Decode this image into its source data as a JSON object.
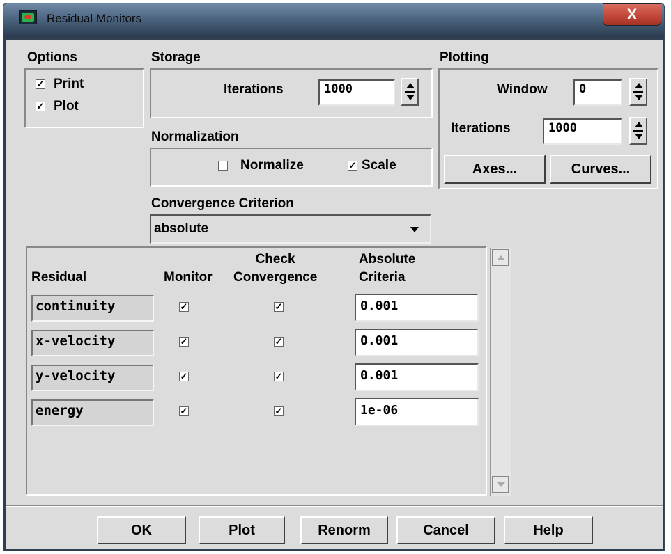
{
  "window": {
    "title": "Residual Monitors",
    "close_glyph": "X"
  },
  "options": {
    "label": "Options",
    "print": {
      "label": "Print",
      "checked": true
    },
    "plot": {
      "label": "Plot",
      "checked": true
    }
  },
  "storage": {
    "label": "Storage",
    "iterations_label": "Iterations",
    "iterations_value": "1000"
  },
  "normalization": {
    "label": "Normalization",
    "normalize": {
      "label": "Normalize",
      "checked": false
    },
    "scale": {
      "label": "Scale",
      "checked": true
    }
  },
  "convergence": {
    "label": "Convergence Criterion",
    "selected": "absolute"
  },
  "plotting": {
    "label": "Plotting",
    "window_label": "Window",
    "window_value": "0",
    "iterations_label": "Iterations",
    "iterations_value": "1000",
    "axes_button": "Axes...",
    "curves_button": "Curves..."
  },
  "table": {
    "headers": {
      "residual": "Residual",
      "monitor": "Monitor",
      "check_line1": "Check",
      "check_line2": "Convergence",
      "abs_line1": "Absolute",
      "abs_line2": "Criteria"
    },
    "rows": [
      {
        "name": "continuity",
        "monitor": true,
        "check": true,
        "criteria": "0.001"
      },
      {
        "name": "x-velocity",
        "monitor": true,
        "check": true,
        "criteria": "0.001"
      },
      {
        "name": "y-velocity",
        "monitor": true,
        "check": true,
        "criteria": "0.001"
      },
      {
        "name": "energy",
        "monitor": true,
        "check": true,
        "criteria": "1e-06"
      }
    ]
  },
  "buttons": {
    "ok": "OK",
    "plot": "Plot",
    "renorm": "Renorm",
    "cancel": "Cancel",
    "help": "Help"
  },
  "glyphs": {
    "check": "✓"
  },
  "colors": {
    "dialog_bg": "#dcdcdc",
    "close_button": "#c54b3c",
    "titlebar": "#4d6580"
  }
}
